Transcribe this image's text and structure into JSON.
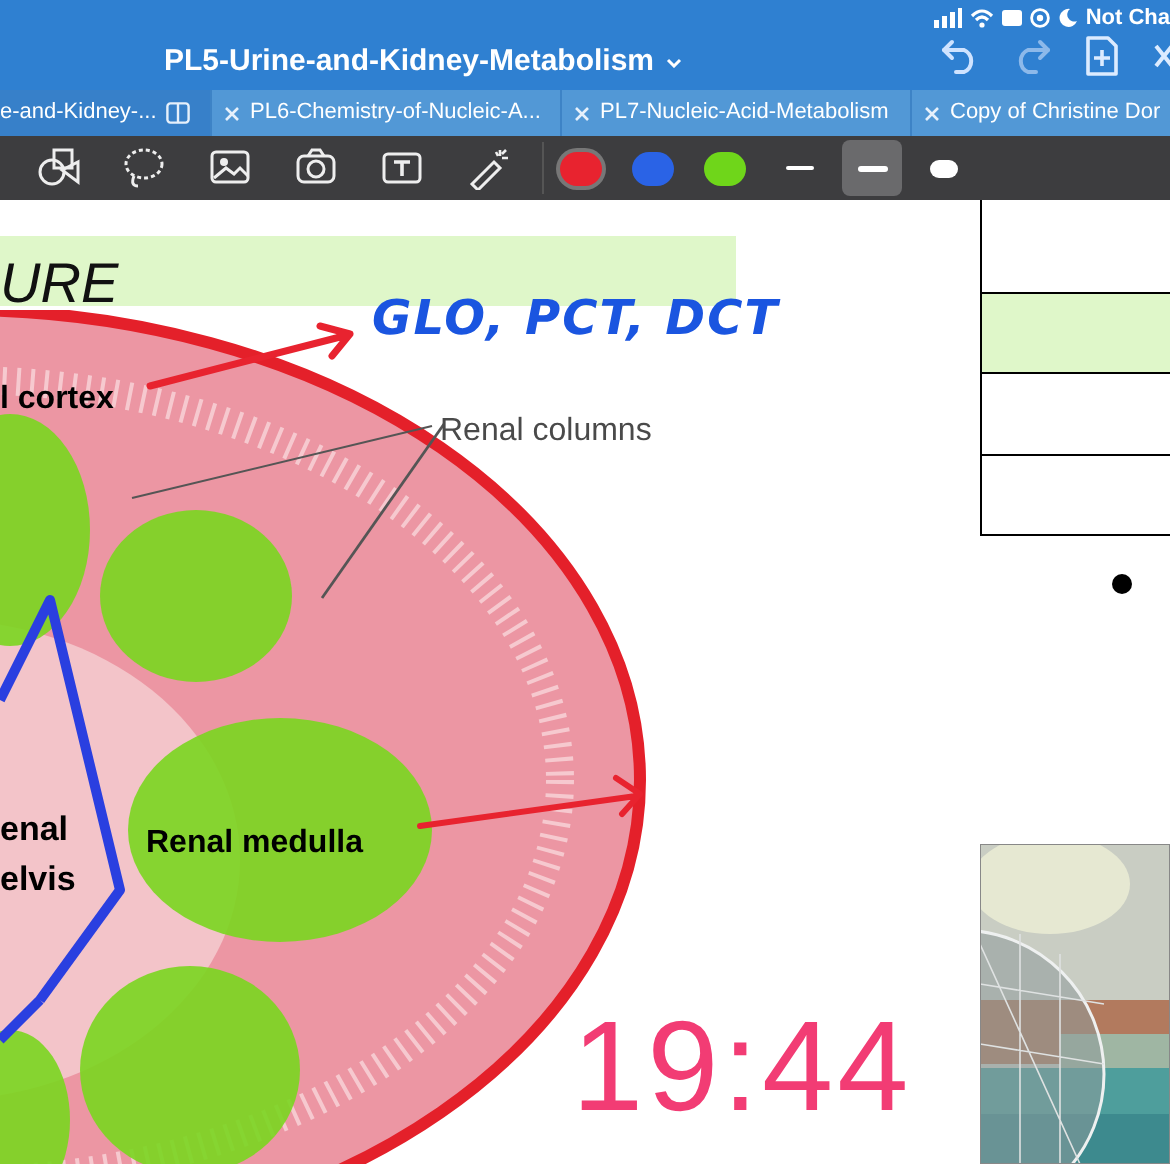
{
  "status_bar": {
    "text": "Not Cha"
  },
  "title_bar": {
    "title": "PL5-Urine-and-Kidney-Metabolism"
  },
  "tabs": [
    {
      "label": "e-and-Kidney-...",
      "selected": true
    },
    {
      "label": "PL6-Chemistry-of-Nucleic-A...",
      "selected": false
    },
    {
      "label": "PL7-Nucleic-Acid-Metabolism",
      "selected": false
    },
    {
      "label": "Copy of Christine Dor",
      "selected": false
    }
  ],
  "toolbar": {
    "colors": [
      {
        "color": "#e8232f",
        "selected": true
      },
      {
        "color": "#2a63e6",
        "selected": false
      },
      {
        "color": "#6fd61a",
        "selected": false
      }
    ],
    "stroke_widths": [
      {
        "kind": "thin",
        "selected": false
      },
      {
        "kind": "medium",
        "selected": true
      },
      {
        "kind": "thick",
        "selected": false
      }
    ]
  },
  "page": {
    "heading": "URE",
    "handwriting": "GLO, PCT, DCT",
    "labels": [
      {
        "text": "l cortex",
        "kind": "bold"
      },
      {
        "text": "Renal columns",
        "kind": "plain"
      },
      {
        "text": "enal",
        "kind": "bold"
      },
      {
        "text": "elvis",
        "kind": "bold"
      },
      {
        "text": "Renal medulla",
        "kind": "bold"
      }
    ],
    "table_rows": [
      {
        "highlighted": false
      },
      {
        "highlighted": true
      },
      {
        "highlighted": false
      },
      {
        "highlighted": false
      }
    ],
    "clock": "19:44"
  }
}
